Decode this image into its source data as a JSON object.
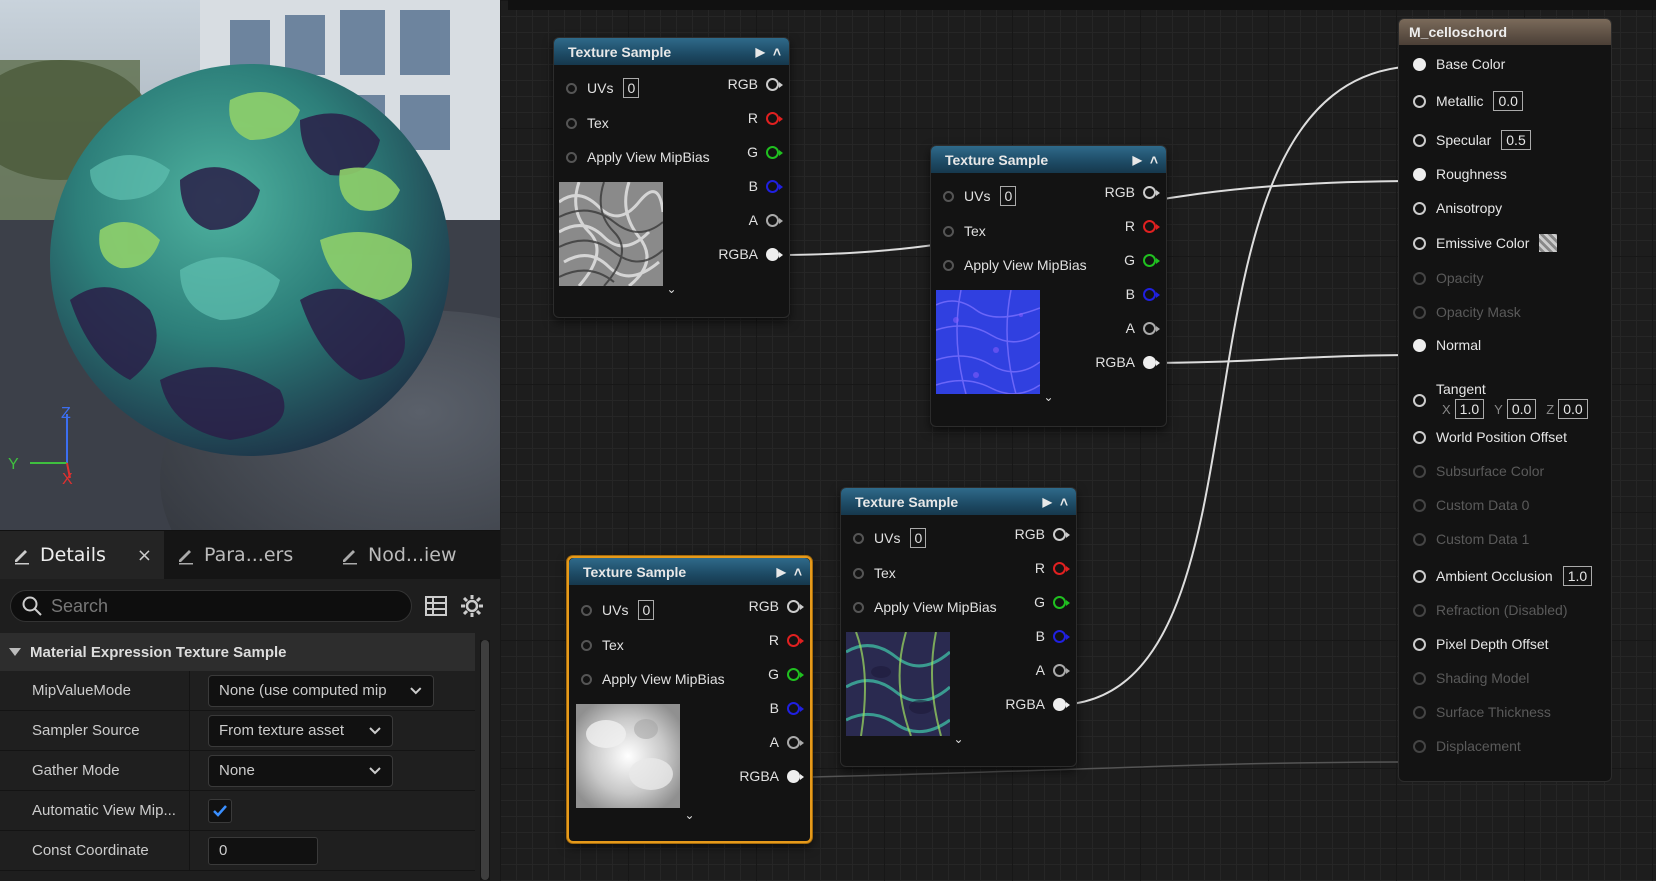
{
  "viewport": {
    "axes": {
      "z": "Z",
      "y": "Y",
      "x": "X"
    }
  },
  "details": {
    "tabs": [
      {
        "label": "Details",
        "close": "×",
        "icon": "pencil-icon"
      },
      {
        "label": "Para...ers",
        "icon": "pencil-icon"
      },
      {
        "label": "Nod...iew",
        "icon": "pencil-icon"
      }
    ],
    "search_placeholder": "Search",
    "section_title": "Material Expression Texture Sample",
    "properties": [
      {
        "label": "MipValueMode",
        "value": "None (use computed mip"
      },
      {
        "label": "Sampler Source",
        "value": "From texture asset"
      },
      {
        "label": "Gather Mode",
        "value": "None"
      },
      {
        "label": "Automatic View Mip...",
        "checked": true
      },
      {
        "label": "Const Coordinate",
        "value": "0"
      }
    ]
  },
  "nodes": {
    "title": "Texture Sample",
    "inputs": {
      "uvs": "UVs",
      "uvs_value": "0",
      "tex": "Tex",
      "mip": "Apply View MipBias"
    },
    "outputs": {
      "rgb": "RGB",
      "r": "R",
      "g": "G",
      "b": "B",
      "a": "A",
      "rgba": "RGBA"
    },
    "pin_colors": {
      "rgb": "#cccccc",
      "r": "#e02020",
      "g": "#20c020",
      "b": "#2020e0",
      "a": "#aaaaaa",
      "rgba": "#eeeeee"
    }
  },
  "material": {
    "title": "M_celloschord",
    "pins": [
      {
        "label": "Base Color",
        "state": "con"
      },
      {
        "label": "Metallic",
        "state": "on",
        "value": "0.0"
      },
      {
        "label": "Specular",
        "state": "on",
        "value": "0.5"
      },
      {
        "label": "Roughness",
        "state": "con"
      },
      {
        "label": "Anisotropy",
        "state": "on"
      },
      {
        "label": "Emissive Color",
        "state": "on"
      },
      {
        "label": "Opacity",
        "state": "dis"
      },
      {
        "label": "Opacity Mask",
        "state": "dis"
      },
      {
        "label": "Normal",
        "state": "con"
      },
      {
        "label": "Tangent",
        "state": "on",
        "x": "1.0",
        "y": "0.0",
        "z": "0.0",
        "xl": "X",
        "yl": "Y",
        "zl": "Z"
      },
      {
        "label": "World Position Offset",
        "state": "on"
      },
      {
        "label": "Subsurface Color",
        "state": "dis"
      },
      {
        "label": "Custom Data 0",
        "state": "dis"
      },
      {
        "label": "Custom Data 1",
        "state": "dis"
      },
      {
        "label": "Ambient Occlusion",
        "state": "on",
        "value": "1.0"
      },
      {
        "label": "Refraction (Disabled)",
        "state": "dis"
      },
      {
        "label": "Pixel Depth Offset",
        "state": "on"
      },
      {
        "label": "Shading Model",
        "state": "dis"
      },
      {
        "label": "Surface Thickness",
        "state": "dis"
      },
      {
        "label": "Displacement",
        "state": "dis"
      }
    ]
  }
}
